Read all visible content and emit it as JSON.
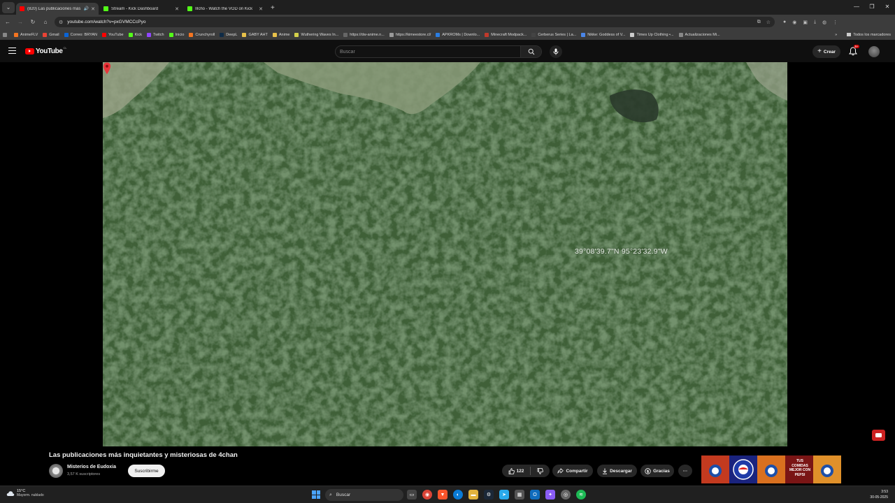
{
  "browser": {
    "tabs": [
      {
        "title": "(820) Las publicaciones más",
        "favicon_color": "#ff0000",
        "active": true,
        "audio": true
      },
      {
        "title": "Stream - Kick Dashboard",
        "favicon_color": "#53fc18",
        "active": false
      },
      {
        "title": "Illcho - Watch the VOD on Kick",
        "favicon_color": "#53fc18",
        "active": false
      }
    ],
    "new_tab_icon": "plus-icon",
    "url": "youtube.com/watch?v=pxGVMCCcPyo",
    "bookmarks": [
      {
        "label": "AnimeFLV",
        "color": "#f47521"
      },
      {
        "label": "Gmail",
        "color": "#ea4335"
      },
      {
        "label": "Correo: BRYAN",
        "color": "#0a64d6"
      },
      {
        "label": "YouTube",
        "color": "#ff0000"
      },
      {
        "label": "Kick",
        "color": "#53fc18"
      },
      {
        "label": "Twitch",
        "color": "#9146ff"
      },
      {
        "label": "Inicio",
        "color": "#53fc18"
      },
      {
        "label": "Crunchyroll",
        "color": "#f47521"
      },
      {
        "label": "DeepL",
        "color": "#0f2b46"
      },
      {
        "label": "GABY AHT",
        "color": "#e8c14a"
      },
      {
        "label": "Anime",
        "color": "#e8c14a"
      },
      {
        "label": "Wuthering Waves In...",
        "color": "#d4d04a"
      },
      {
        "label": "https://dw-anime.n...",
        "color": "#666666"
      },
      {
        "label": "https://kimeestore.cl/",
        "color": "#999999"
      },
      {
        "label": "APKROMs | Downlo...",
        "color": "#2a7de1"
      },
      {
        "label": "Minecraft Modpack...",
        "color": "#c0392b"
      },
      {
        "label": "Cerberus Series | La...",
        "color": "#444444"
      },
      {
        "label": "Nikke: Goddess of V...",
        "color": "#4a86e8"
      },
      {
        "label": "Times Up Clothing •...",
        "color": "#cccccc"
      },
      {
        "label": "Actualizaciones Mi...",
        "color": "#888888"
      }
    ],
    "bookmarks_more": "»",
    "all_bookmarks": "Todos los marcadores"
  },
  "youtube": {
    "logo_text": "YouTube",
    "country_code": "CL",
    "search_placeholder": "Buscar",
    "create_label": "Crear",
    "notifications_badge": "9+"
  },
  "video": {
    "overlay_coordinates": "39°08'39.7\"N 95°23'32.9\"W",
    "title": "Las publicaciones más inquietantes y misteriosas de 4chan",
    "channel_name": "Misterios de Eudoxia",
    "subscribers": "3,57 K suscriptores",
    "subscribe_label": "Suscribirme",
    "like_count": "122",
    "share_label": "Compartir",
    "download_label": "Descargar",
    "thanks_label": "Gracias",
    "ad_banner_text": "TUS COMIDAS MEJOR CON PEPSI"
  },
  "taskbar": {
    "weather_temp": "15°C",
    "weather_desc": "Mayorm. nublado",
    "search_label": "Buscar",
    "time": "3:53",
    "date": "30-05-2025"
  },
  "colors": {
    "accent": "#ff0000",
    "forest": "#3f6138"
  }
}
